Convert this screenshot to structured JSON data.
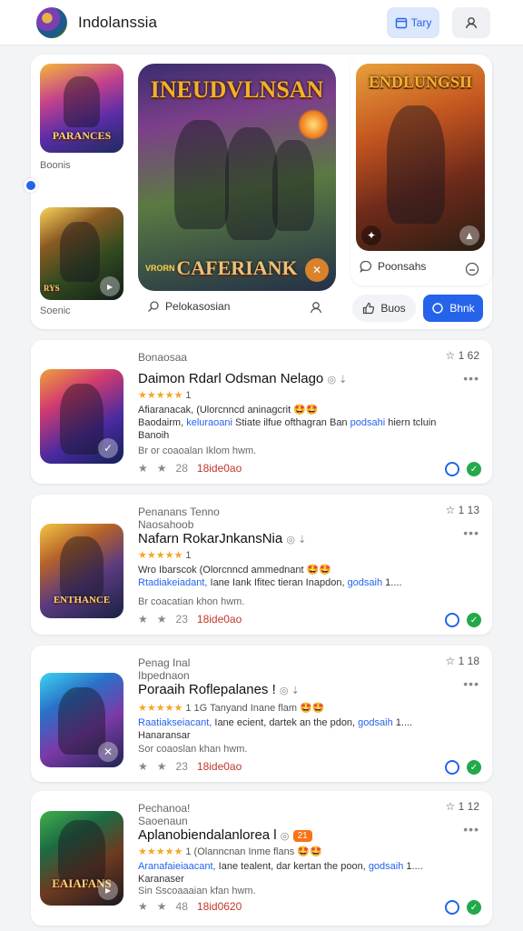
{
  "header": {
    "title": "Indolanssia",
    "primary_button_label": "Tary",
    "icons": {
      "primary": "calendar-icon",
      "user": "user-icon"
    }
  },
  "hero": {
    "left_top": {
      "banner": "PARANCES",
      "caption": "Boonis"
    },
    "left_bottom": {
      "banner": "RYS",
      "caption": "Soenic"
    },
    "center": {
      "title": "INEUDVLNSAN",
      "subtitle": "CAFERIANK",
      "badge": "VRORN",
      "caption": "Pelokasosian"
    },
    "right": {
      "title": "ENDLUNGSII",
      "caption": "Poonsahs"
    },
    "buttons": {
      "secondary": "Buos",
      "primary": "Bhnk"
    }
  },
  "cards": [
    {
      "category": "Bonaosaa",
      "subcategory": "",
      "rank": "1 62",
      "title": "Daimon Rdarl Odsman Nelago",
      "rating": "★★★★★",
      "rating_count": "1",
      "line1": "Afiaranacak, (Ulorcnncd aninagcrit 🤩🤩",
      "line2_a": "Baodairm, ",
      "line2_link1": "keluraoani",
      "line2_b": " Stiate ilfue ofthagran Ban ",
      "line2_link2": "podsahi",
      "line2_c": " hiern tcluin",
      "line3": "Banoih",
      "meta": "Br or coaoalan Iklom hwm.",
      "stat": "28",
      "count": "18ide0ao"
    },
    {
      "category": "Penanans Tenno",
      "subcategory": "Naosahoob",
      "rank": "1 13",
      "title": "Nafarn RokarJnkansNia",
      "rating": "★★★★★",
      "rating_count": "1",
      "line1": "Wro Ibarscok (Olorcnncd ammednant 🤩🤩",
      "line2_a": "",
      "line2_link1": "Rtadiakeiadant,",
      "line2_b": " Iane Iank Ifitec tieran Inapdon, ",
      "line2_link2": "godsaih",
      "line2_c": " 1....",
      "line3": "",
      "meta": "Br coacatian khon hwm.",
      "stat": "23",
      "count": "18ide0ao"
    },
    {
      "category": "Penag Inal",
      "subcategory": "Ibpednaon",
      "rank": "1 18",
      "title": "Poraaih Roflepalanes !",
      "rating": "★★★★★",
      "rating_count": "1 1G Tanyand Inane flam 🤩🤩",
      "line1": "",
      "line2_a": "",
      "line2_link1": "Raatiakseiacant,",
      "line2_b": " Iane ecient, dartek an the pdon, ",
      "line2_link2": "godsaih",
      "line2_c": " 1....",
      "line3": "Hanaransar",
      "meta": "Sor coaoslan khan hwm.",
      "stat": "23",
      "count": "18ide0ao"
    },
    {
      "category": "Pechanoa!",
      "subcategory": "Saoenaun",
      "rank": "1 12",
      "title": "Aplanobiendalanlorea l",
      "tag": "21",
      "rating": "★★★★★",
      "rating_count": "1 (Olanncnan Inme flans 🤩🤩",
      "line1": "",
      "line2_a": "",
      "line2_link1": "Aranafaieiaacant,",
      "line2_b": " Iane tealent, dar kertan the poon, ",
      "line2_link2": "godsaih",
      "line2_c": " 1....",
      "line3": "Karanaser",
      "meta": "Sin Sscoaaaian kfan hwm.",
      "stat": "48",
      "count": "18id0620"
    }
  ]
}
